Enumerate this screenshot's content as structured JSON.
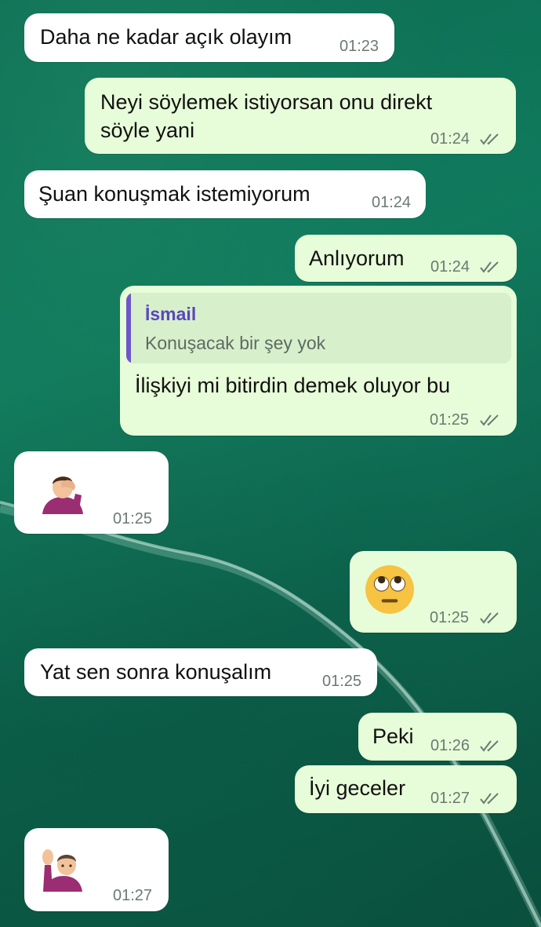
{
  "chat": {
    "messages": [
      {
        "direction": "in",
        "text": "Daha ne kadar açık olayım",
        "time": "01:23"
      },
      {
        "direction": "out",
        "text_line1": "Neyi söylemek istiyorsan onu direkt",
        "text_line2": "söyle yani",
        "time": "01:24",
        "status": "read"
      },
      {
        "direction": "in",
        "text": "Şuan konuşmak istemiyorum",
        "time": "01:24"
      },
      {
        "direction": "out",
        "text": "Anlıyorum",
        "time": "01:24",
        "status": "read"
      },
      {
        "direction": "out",
        "reply_to": {
          "name": "İsmail",
          "text": "Konuşacak bir şey yok"
        },
        "text": "İlişkiyi mi bitirdin demek oluyor bu",
        "time": "01:25",
        "status": "read"
      },
      {
        "direction": "in",
        "emoji": "person-facepalming",
        "time": "01:25"
      },
      {
        "direction": "out",
        "emoji": "face-with-rolling-eyes",
        "time": "01:25",
        "status": "read"
      },
      {
        "direction": "in",
        "text": "Yat sen sonra konuşalım",
        "time": "01:25"
      },
      {
        "direction": "out",
        "text": "Peki",
        "time": "01:26",
        "status": "read"
      },
      {
        "direction": "out",
        "text": "İyi geceler",
        "time": "01:27",
        "status": "read"
      },
      {
        "direction": "in",
        "emoji": "person-raising-hand",
        "time": "01:27"
      }
    ]
  },
  "colors": {
    "incoming_bubble": "#ffffff",
    "outgoing_bubble": "#e7fcd8",
    "reply_name": "#5a46c0",
    "wallpaper": "#0d6b52"
  }
}
